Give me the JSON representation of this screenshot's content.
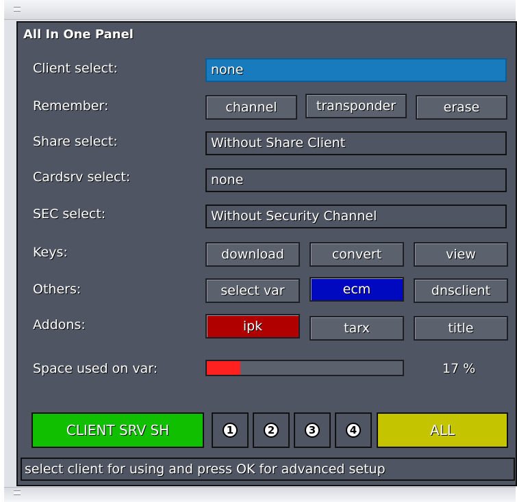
{
  "panel": {
    "title": "All In One Panel"
  },
  "rows": {
    "client_select": {
      "label": "Client select:",
      "value": "none"
    },
    "remember": {
      "label": "Remember:",
      "buttons": [
        "channel",
        "transponder",
        "erase"
      ]
    },
    "share_select": {
      "label": "Share select:",
      "value": "Without Share Client"
    },
    "cardsrv_select": {
      "label": "Cardsrv select:",
      "value": "none"
    },
    "sec_select": {
      "label": "SEC select:",
      "value": "Without Security Channel"
    },
    "keys": {
      "label": "Keys:",
      "buttons": [
        "download",
        "convert",
        "view"
      ]
    },
    "others": {
      "label": "Others:",
      "buttons": [
        "select var",
        "ecm",
        "dnsclient"
      ]
    },
    "addons": {
      "label": "Addons:",
      "buttons": [
        "ipk",
        "tarx",
        "title"
      ]
    },
    "space": {
      "label": "Space used on var:",
      "percent_text": "17 %",
      "fraction": 0.17
    }
  },
  "color_keys": {
    "green": "CLIENT SRV SH",
    "numbers": [
      "1",
      "2",
      "3",
      "4"
    ],
    "yellow": "ALL"
  },
  "status": "select client for using and press OK for advanced setup",
  "colors": {
    "panel_bg": "#4f5562",
    "selected_field": "#177bbd",
    "ecm_button": "#0008c0",
    "ipk_button": "#b00000",
    "progress_fill": "#ff2020",
    "green_key": "#10c000",
    "yellow_key": "#c4c400"
  }
}
